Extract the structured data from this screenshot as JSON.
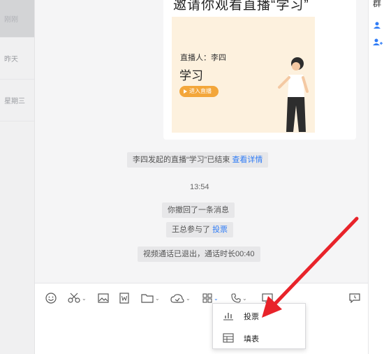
{
  "sidebar": {
    "items": [
      {
        "label": "刚刚"
      },
      {
        "label": "昨天"
      },
      {
        "label": "星期三"
      }
    ]
  },
  "right_panel": {
    "title": "群"
  },
  "live_card": {
    "title": "邀请你观看直播“学习”",
    "host": "直播人：李四",
    "topic": "学习",
    "enter_button": "进入直播"
  },
  "messages": {
    "live_ended_text": "李四发起的直播“学习”已结束",
    "live_ended_link": "查看详情",
    "time": "13:54",
    "recall_text": "你撤回了一条消息",
    "vote_text": "王总参与了",
    "vote_link": "投票",
    "video_call_text": "视频通话已退出，通话时长00:40"
  },
  "menu": {
    "items": [
      {
        "label": "投票"
      },
      {
        "label": "填表"
      }
    ]
  },
  "colors": {
    "accent": "#2f7cf6",
    "annotation_arrow": "#e8232a",
    "live_button": "#f3a63a"
  },
  "icons": [
    "emoji-icon",
    "scissors-icon",
    "image-icon",
    "word-doc-icon",
    "folder-icon",
    "cloud-disk-icon",
    "apps-grid-icon",
    "phone-icon",
    "screen-share-icon",
    "message-history-icon",
    "bar-chart-icon",
    "table-icon"
  ]
}
